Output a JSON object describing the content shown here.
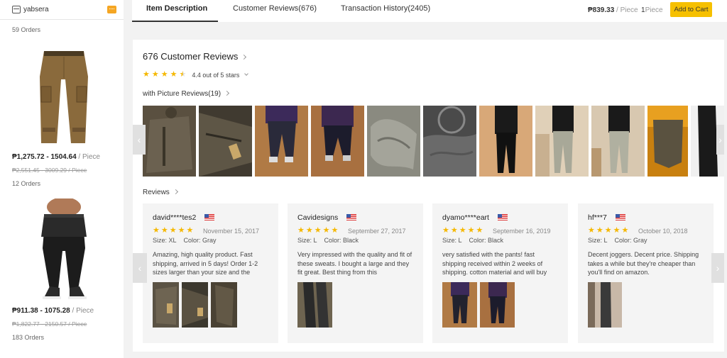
{
  "store": {
    "name": "yabsera"
  },
  "sidebar": {
    "top_orders": "59 Orders",
    "products": [
      {
        "price": "₱1,275.72 - 1504.64",
        "unit": " / Piece",
        "old_price": "₱2,551.45 - 3009.29 / Piece",
        "orders": "12 Orders"
      },
      {
        "price": "₱911.38 - 1075.28",
        "unit": " / Piece",
        "old_price": "₱1,822.77 - 2150.57 / Piece",
        "orders": "183 Orders"
      }
    ]
  },
  "nav": {
    "tabs": [
      "Item Description",
      "Customer Reviews(676)",
      "Transaction History(2405)"
    ],
    "price": "₱839.33",
    "price_unit": " / Piece",
    "qty": "1",
    "qty_unit": "Piece",
    "cart_label": "Add to Cart"
  },
  "reviews": {
    "title": "676 Customer Reviews",
    "rating_text": "4.4 out of 5 stars",
    "rating_value": 4.4,
    "pic_reviews_label": "with Picture Reviews(19)",
    "reviews_label": "Reviews",
    "cards": [
      {
        "user": "david****tes2",
        "date": "November 15, 2017",
        "size": "Size: XL",
        "color": "Color: Gray",
        "stars": 5,
        "text": "Amazing, high quality product. Fast shipping, arrived in 5 days! Order 1-2 sizes larger than your size and the"
      },
      {
        "user": "Cavidesigns",
        "date": "September 27, 2017",
        "size": "Size: L",
        "color": "Color: Black",
        "stars": 5,
        "text": "Very impressed with the quality and fit of these sweats. I bought a large and they fit great. Best thing from this"
      },
      {
        "user": "dyamo****eart",
        "date": "September 16, 2019",
        "size": "Size: L",
        "color": "Color: Black",
        "stars": 5,
        "text": "very satisfied with the pants! fast shipping received within 2 weeks of shipping. cotton material and will buy"
      },
      {
        "user": "hf***7",
        "date": "October 10, 2018",
        "size": "Size: L",
        "color": "Color: Gray",
        "stars": 5,
        "text": "Decent joggers. Decent price. Shipping takes a while but they're cheaper than you'll find on amazon."
      }
    ]
  },
  "colors": {
    "accent": "#f6c000",
    "star": "#f5b800"
  },
  "icons": [
    "store-icon",
    "chat-icon",
    "star-icon",
    "chevron-right-icon",
    "chevron-down-icon",
    "flag-us-icon",
    "arrow-left-icon",
    "arrow-right-icon"
  ]
}
